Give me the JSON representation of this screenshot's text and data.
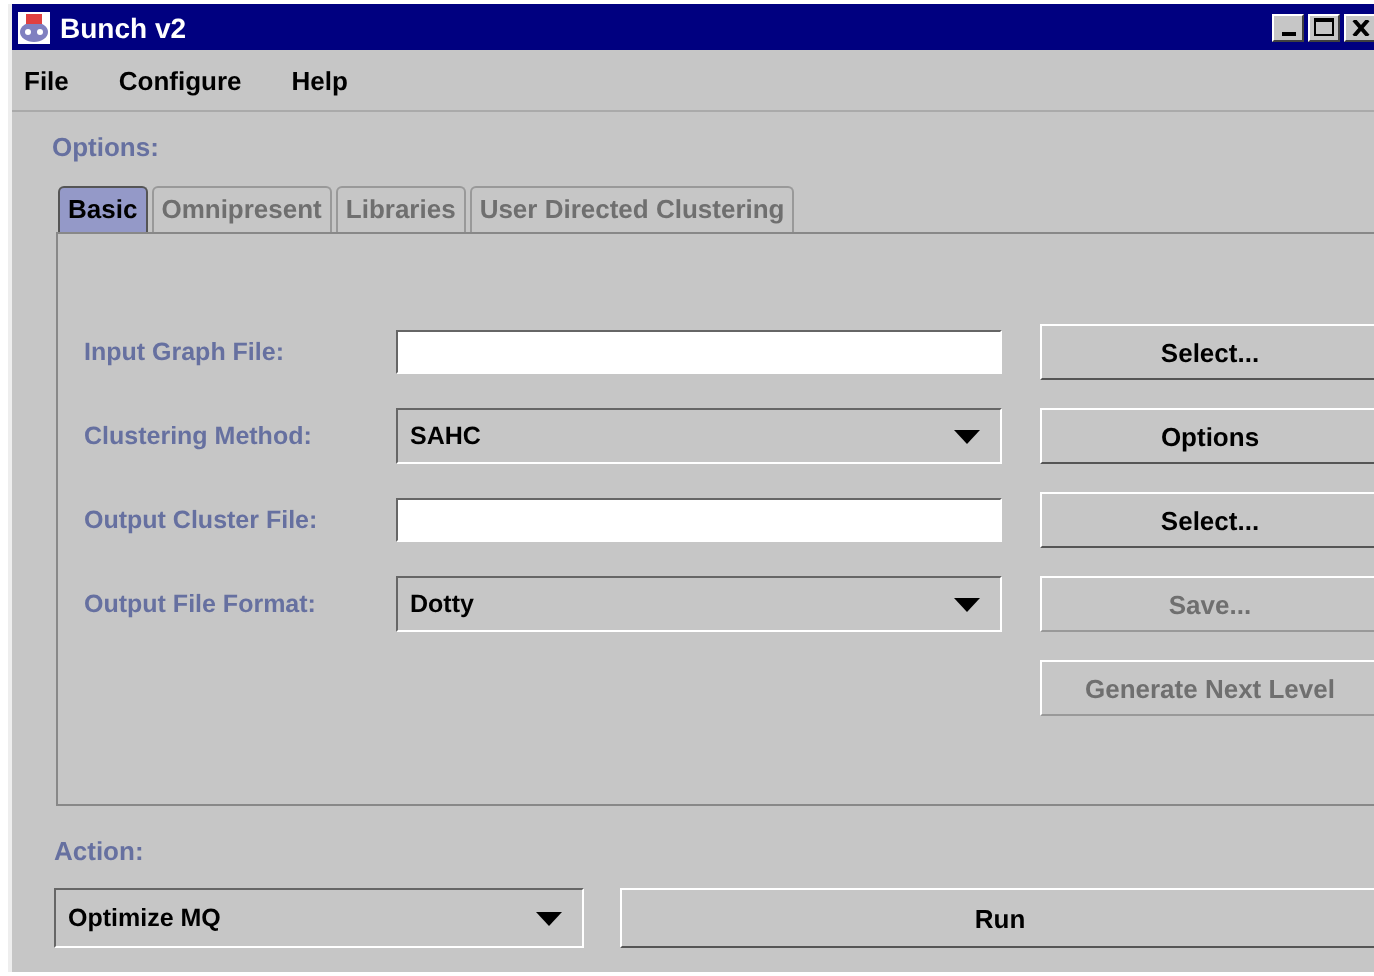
{
  "window": {
    "title": "Bunch v2"
  },
  "menu": [
    {
      "label": "File"
    },
    {
      "label": "Configure"
    },
    {
      "label": "Help"
    }
  ],
  "options_label": "Options:",
  "tabs": [
    {
      "label": "Basic",
      "selected": true,
      "disabled": false
    },
    {
      "label": "Omnipresent",
      "selected": false,
      "disabled": true
    },
    {
      "label": "Libraries",
      "selected": false,
      "disabled": true
    },
    {
      "label": "User Directed Clustering",
      "selected": false,
      "disabled": true
    }
  ],
  "rows": [
    {
      "label": "Input Graph File:",
      "kind": "text",
      "value": "",
      "button": {
        "label": "Select...",
        "disabled": false
      }
    },
    {
      "label": "Clustering Method:",
      "kind": "combo",
      "value": "SAHC",
      "button": {
        "label": "Options",
        "disabled": false
      }
    },
    {
      "label": "Output Cluster File:",
      "kind": "text",
      "value": "",
      "button": {
        "label": "Select...",
        "disabled": false
      }
    },
    {
      "label": "Output File Format:",
      "kind": "combo",
      "value": "Dotty",
      "button": {
        "label": "Save...",
        "disabled": true
      }
    },
    {
      "kind": "none",
      "button": {
        "label": "Generate Next Level",
        "disabled": true
      }
    }
  ],
  "action": {
    "label": "Action:",
    "value": "Optimize MQ",
    "button": {
      "label": "Run",
      "disabled": false
    }
  }
}
